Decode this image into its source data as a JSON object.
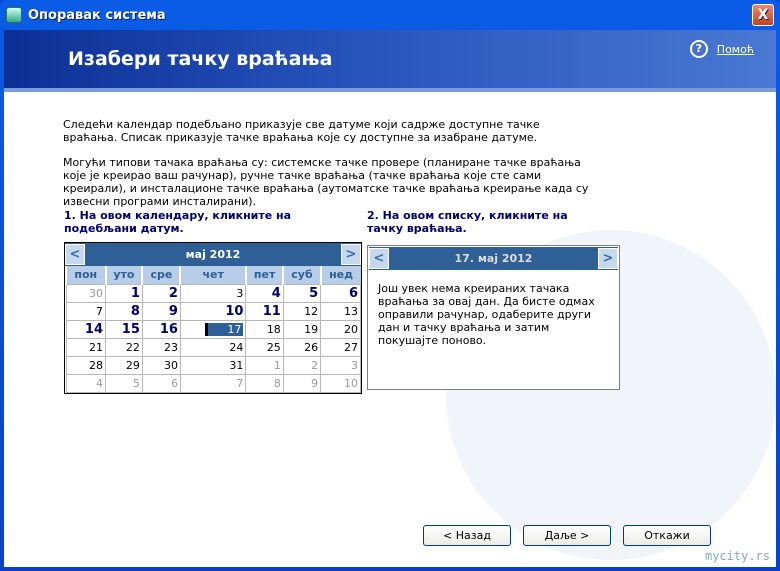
{
  "window": {
    "title": "Опоравак система",
    "close": "X"
  },
  "header": {
    "title": "Изабери тачку враћања",
    "help": "Помоћ",
    "help_icon": "?"
  },
  "intro": {
    "p1": "Следећи календар подебљано приказује све датуме који садрже доступне тачке враћања. Списак приказује тачке враћања које су доступне за изабране датуме.",
    "p2": "Могући типови тачака враћања су: системске тачке провере (планиране тачке враћања које је креирао ваш рачунар), ручне тачке враћања (тачке враћања које сте сами креирали), и инсталационе тачке враћања (аутоматске тачке враћања креирање када су извесни програми инсталирани)."
  },
  "step1": "1. На овом календару, кликните на подебљани датум.",
  "step2": "2. На овом списку, кликните на тачку враћања.",
  "calendar": {
    "month": "мај 2012",
    "prev": "<",
    "next": ">",
    "weekdays": [
      "пон",
      "уто",
      "сре",
      "чет",
      "пет",
      "суб",
      "нед"
    ],
    "weeks": [
      [
        {
          "d": "30",
          "s": "g"
        },
        {
          "d": "1",
          "s": "b"
        },
        {
          "d": "2",
          "s": "b"
        },
        {
          "d": "3",
          "s": ""
        },
        {
          "d": "4",
          "s": "b"
        },
        {
          "d": "5",
          "s": "b"
        },
        {
          "d": "6",
          "s": "b"
        }
      ],
      [
        {
          "d": "7",
          "s": ""
        },
        {
          "d": "8",
          "s": "b"
        },
        {
          "d": "9",
          "s": "b"
        },
        {
          "d": "10",
          "s": "b"
        },
        {
          "d": "11",
          "s": "b"
        },
        {
          "d": "12",
          "s": ""
        },
        {
          "d": "13",
          "s": ""
        }
      ],
      [
        {
          "d": "14",
          "s": "b"
        },
        {
          "d": "15",
          "s": "b"
        },
        {
          "d": "16",
          "s": "b"
        },
        {
          "d": "17",
          "s": "sel"
        },
        {
          "d": "18",
          "s": ""
        },
        {
          "d": "19",
          "s": ""
        },
        {
          "d": "20",
          "s": ""
        }
      ],
      [
        {
          "d": "21",
          "s": ""
        },
        {
          "d": "22",
          "s": ""
        },
        {
          "d": "23",
          "s": ""
        },
        {
          "d": "24",
          "s": ""
        },
        {
          "d": "25",
          "s": ""
        },
        {
          "d": "26",
          "s": ""
        },
        {
          "d": "27",
          "s": ""
        }
      ],
      [
        {
          "d": "28",
          "s": ""
        },
        {
          "d": "29",
          "s": ""
        },
        {
          "d": "30",
          "s": ""
        },
        {
          "d": "31",
          "s": ""
        },
        {
          "d": "1",
          "s": "g"
        },
        {
          "d": "2",
          "s": "g"
        },
        {
          "d": "3",
          "s": "g"
        }
      ],
      [
        {
          "d": "4",
          "s": "g"
        },
        {
          "d": "5",
          "s": "g"
        },
        {
          "d": "6",
          "s": "g"
        },
        {
          "d": "7",
          "s": "g"
        },
        {
          "d": "8",
          "s": "g"
        },
        {
          "d": "9",
          "s": "g"
        },
        {
          "d": "10",
          "s": "g"
        }
      ]
    ]
  },
  "list": {
    "date": "17. мај 2012",
    "prev": "<",
    "next": ">",
    "message": "Још увек нема креираних тачака враћања за овај дан. Да бисте одмах оправили рачунар, одаберите други дан и тачку враћања и затим покушајте поново."
  },
  "buttons": {
    "back": "< Назад",
    "next": "Даље >",
    "cancel": "Откажи"
  },
  "watermark": "mycity.rs"
}
